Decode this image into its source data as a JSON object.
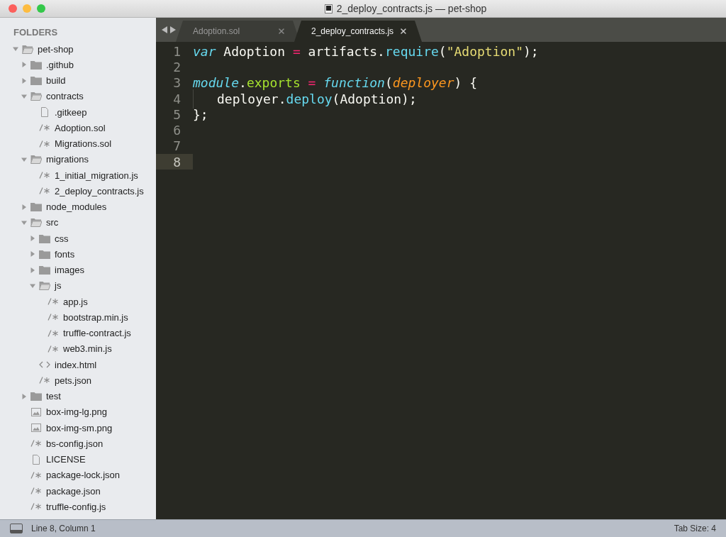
{
  "window": {
    "title": "2_deploy_contracts.js — pet-shop"
  },
  "sidebar": {
    "heading": "FOLDERS",
    "tree": [
      {
        "name": "pet-shop",
        "kind": "folder",
        "expanded": true,
        "children": [
          {
            "name": ".github",
            "kind": "folder",
            "expanded": false
          },
          {
            "name": "build",
            "kind": "folder",
            "expanded": false
          },
          {
            "name": "contracts",
            "kind": "folder",
            "expanded": true,
            "children": [
              {
                "name": ".gitkeep",
                "kind": "plain"
              },
              {
                "name": "Adoption.sol",
                "kind": "code"
              },
              {
                "name": "Migrations.sol",
                "kind": "code"
              }
            ]
          },
          {
            "name": "migrations",
            "kind": "folder",
            "expanded": true,
            "children": [
              {
                "name": "1_initial_migration.js",
                "kind": "code"
              },
              {
                "name": "2_deploy_contracts.js",
                "kind": "code"
              }
            ]
          },
          {
            "name": "node_modules",
            "kind": "folder",
            "expanded": false
          },
          {
            "name": "src",
            "kind": "folder",
            "expanded": true,
            "children": [
              {
                "name": "css",
                "kind": "folder",
                "expanded": false
              },
              {
                "name": "fonts",
                "kind": "folder",
                "expanded": false
              },
              {
                "name": "images",
                "kind": "folder",
                "expanded": false
              },
              {
                "name": "js",
                "kind": "folder",
                "expanded": true,
                "children": [
                  {
                    "name": "app.js",
                    "kind": "code"
                  },
                  {
                    "name": "bootstrap.min.js",
                    "kind": "code"
                  },
                  {
                    "name": "truffle-contract.js",
                    "kind": "code"
                  },
                  {
                    "name": "web3.min.js",
                    "kind": "code"
                  }
                ]
              },
              {
                "name": "index.html",
                "kind": "markup"
              },
              {
                "name": "pets.json",
                "kind": "code"
              }
            ]
          },
          {
            "name": "test",
            "kind": "folder",
            "expanded": false
          },
          {
            "name": "box-img-lg.png",
            "kind": "image"
          },
          {
            "name": "box-img-sm.png",
            "kind": "image"
          },
          {
            "name": "bs-config.json",
            "kind": "code"
          },
          {
            "name": "LICENSE",
            "kind": "plain"
          },
          {
            "name": "package-lock.json",
            "kind": "code"
          },
          {
            "name": "package.json",
            "kind": "code"
          },
          {
            "name": "truffle-config.js",
            "kind": "code"
          }
        ]
      }
    ]
  },
  "tabs": [
    {
      "label": "Adoption.sol",
      "selected": false
    },
    {
      "label": "2_deploy_contracts.js",
      "selected": true
    }
  ],
  "editor": {
    "lines": [
      {
        "number": "1",
        "indent": false,
        "current": false,
        "tokens": [
          {
            "text": "var",
            "kind": "keyword"
          },
          {
            "text": " Adoption ",
            "kind": "plain"
          },
          {
            "text": "=",
            "kind": "operator"
          },
          {
            "text": " artifacts.",
            "kind": "plain"
          },
          {
            "text": "require",
            "kind": "call"
          },
          {
            "text": "(",
            "kind": "plain"
          },
          {
            "text": "\"Adoption\"",
            "kind": "string"
          },
          {
            "text": ");",
            "kind": "plain"
          }
        ]
      },
      {
        "number": "2",
        "indent": false,
        "current": false
      },
      {
        "number": "3",
        "indent": false,
        "current": false,
        "tokens": [
          {
            "text": "module",
            "kind": "keyword"
          },
          {
            "text": ".",
            "kind": "plain"
          },
          {
            "text": "exports",
            "kind": "property"
          },
          {
            "text": " = ",
            "kind": "operator"
          },
          {
            "text": "function",
            "kind": "keyword"
          },
          {
            "text": "(",
            "kind": "plain"
          },
          {
            "text": "deployer",
            "kind": "param"
          },
          {
            "text": ") {",
            "kind": "plain"
          }
        ]
      },
      {
        "number": "4",
        "indent": true,
        "current": false,
        "tokens": [
          {
            "text": "deployer.",
            "kind": "plain"
          },
          {
            "text": "deploy",
            "kind": "call"
          },
          {
            "text": "(Adoption);",
            "kind": "plain"
          }
        ]
      },
      {
        "number": "5",
        "indent": false,
        "current": false,
        "tokens": [
          {
            "text": "};",
            "kind": "plain"
          }
        ]
      },
      {
        "number": "6",
        "indent": false,
        "current": false
      },
      {
        "number": "7",
        "indent": false,
        "current": false
      },
      {
        "number": "8",
        "indent": false,
        "current": true
      }
    ]
  },
  "status_bar": {
    "position": "Line 8, Column 1",
    "tab_size": "Tab Size: 4"
  }
}
